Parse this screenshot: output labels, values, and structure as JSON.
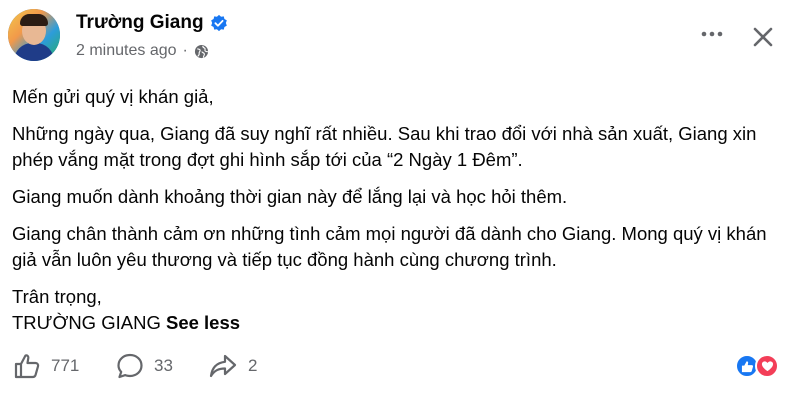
{
  "post": {
    "author": "Trường Giang",
    "timestamp": "2 minutes ago",
    "separator": "·",
    "verified": true,
    "privacy_icon": "globe-icon"
  },
  "content": {
    "greeting": "Mến gửi quý vị khán giả,",
    "p1": "Những ngày qua, Giang đã suy nghĩ rất nhiều. Sau khi trao đổi với nhà sản xuất, Giang xin phép vắng mặt trong đợt ghi hình sắp tới của “2 Ngày 1 Đêm”.",
    "p2": "Giang muốn dành khoảng thời gian này để lắng lại và học hỏi thêm.",
    "p3": "Giang chân thành cảm ơn những tình cảm mọi người đã dành cho Giang. Mong quý vị khán giả vẫn luôn yêu thương và tiếp tục đồng hành cùng chương trình.",
    "closing": "Trân trọng,",
    "signature": "TRƯỜNG GIANG",
    "see_less": "See less"
  },
  "stats": {
    "likes": "771",
    "comments": "33",
    "shares": "2"
  },
  "colors": {
    "accent": "#1877f2",
    "love": "#f33e58",
    "secondary_text": "#65676b"
  }
}
